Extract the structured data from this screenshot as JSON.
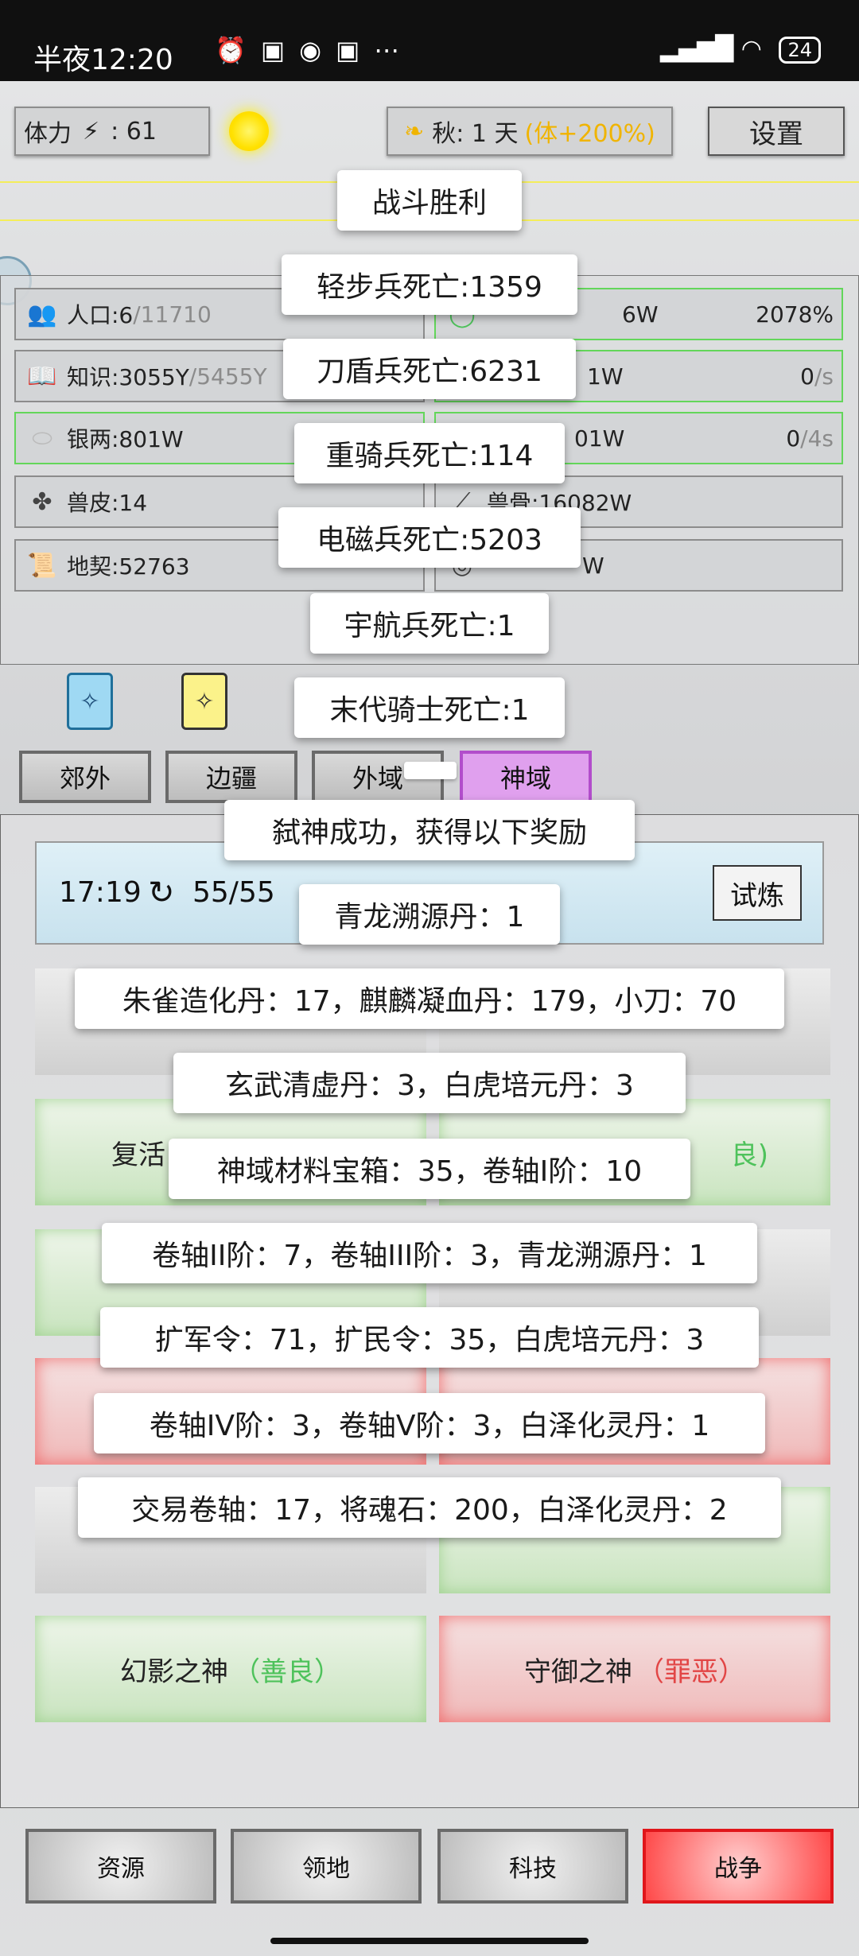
{
  "status_bar": {
    "time": "半夜12:20",
    "icons": [
      "alarm-icon",
      "app-icon",
      "app-icon",
      "app-icon",
      "more-icon"
    ],
    "battery": "24"
  },
  "top": {
    "stamina_label": "体力",
    "stamina_value": "61",
    "season": "秋: 1 天",
    "season_bonus": "(体+200%)",
    "settings": "设置"
  },
  "resources": {
    "population": "人口:6",
    "population_max": "/11710",
    "knowledge": "知识:3055Y",
    "knowledge_max": "/5455Y",
    "silver": "银两:801W",
    "fur": "兽皮:14",
    "deed": "地契:52763",
    "right_row1": "6W",
    "right_row1_pct": "2078%",
    "right_row2": "1W",
    "right_row2_rate": "0",
    "right_row2_unit": "/s",
    "right_row3": "01W",
    "right_row3_rate": "0",
    "right_row3_unit": "/4s",
    "bone": "兽骨:16082W",
    "right_row5": "W"
  },
  "tabs": [
    "郊外",
    "边疆",
    "外域",
    "神域"
  ],
  "timer": {
    "time": "17:19",
    "count": "55/55",
    "trial": "试炼"
  },
  "gods": [
    {
      "name": "复活",
      "tag": "良)"
    },
    {
      "name": "幻影之神",
      "tag": "（善良）"
    },
    {
      "name": "守御之神",
      "tag": "（罪恶）"
    }
  ],
  "bottom_nav": [
    "资源",
    "领地",
    "科技",
    "战争"
  ],
  "battle_log": [
    "战斗胜利",
    "轻步兵死亡:1359",
    "刀盾兵死亡:6231",
    "重骑兵死亡:114",
    "电磁兵死亡:5203",
    "宇航兵死亡:1",
    "末代骑士死亡:1",
    "弑神成功，获得以下奖励",
    "青龙溯源丹：1",
    "朱雀造化丹：17，麒麟凝血丹：179，小刀：70",
    "玄武清虚丹：3，白虎培元丹：3",
    "神域材料宝箱：35，卷轴I阶：10",
    "卷轴II阶：7，卷轴III阶：3，青龙溯源丹：1",
    "扩军令：71，扩民令：35，白虎培元丹：3",
    "卷轴IV阶：3，卷轴V阶：3，白泽化灵丹：1",
    "交易卷轴：17，将魂石：200，白泽化灵丹：2"
  ]
}
